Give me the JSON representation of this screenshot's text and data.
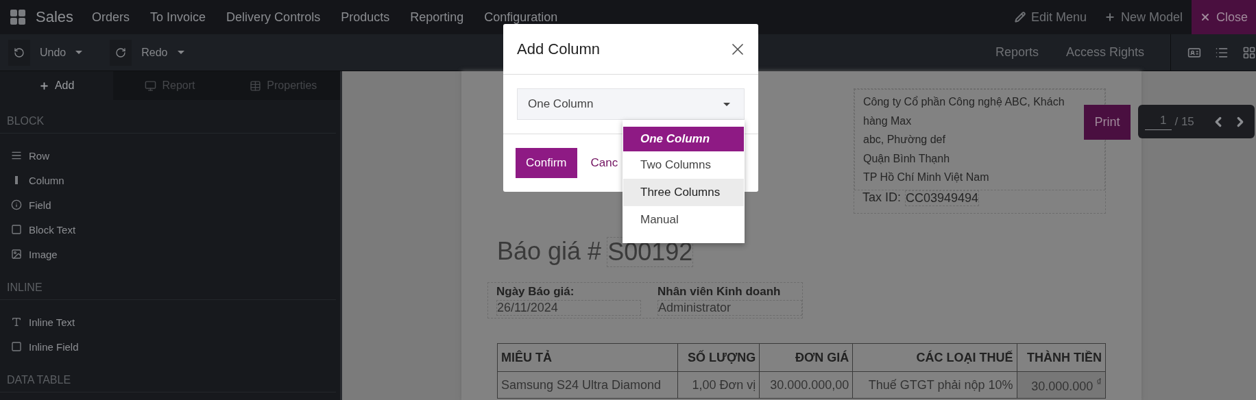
{
  "navbar": {
    "app": "Sales",
    "menu": [
      "Orders",
      "To Invoice",
      "Delivery Controls",
      "Products",
      "Reporting",
      "Configuration"
    ],
    "actions": [
      {
        "label": "Edit Menu",
        "kind": "edit"
      },
      {
        "label": "New Model",
        "kind": "new"
      },
      {
        "label": "Close",
        "kind": "close"
      }
    ]
  },
  "toolbar": {
    "history": [
      {
        "label": "Undo",
        "kind": "undo"
      },
      {
        "label": "Redo",
        "kind": "redo"
      }
    ],
    "links": [
      "Reports",
      "Access Rights"
    ]
  },
  "sidebar": {
    "tabs": [
      {
        "label": "Add",
        "kind": "add",
        "selected": true
      },
      {
        "label": "Report",
        "kind": "report",
        "selected": false
      },
      {
        "label": "Properties",
        "kind": "properties",
        "selected": false
      }
    ],
    "sections": [
      {
        "title": "BLOCK",
        "items": [
          {
            "label": "Row",
            "kind": "row"
          },
          {
            "label": "Column",
            "kind": "column"
          },
          {
            "label": "Field",
            "kind": "field"
          },
          {
            "label": "Block Text",
            "kind": "box"
          },
          {
            "label": "Image",
            "kind": "image"
          }
        ]
      },
      {
        "title": "INLINE",
        "items": [
          {
            "label": "Inline Text",
            "kind": "text"
          },
          {
            "label": "Inline Field",
            "kind": "box"
          }
        ]
      },
      {
        "title": "DATA TABLE"
      }
    ]
  },
  "report": {
    "address": [
      "Công ty Cổ phần Công nghệ ABC, Khách",
      "hàng Max",
      "abc, Phường def",
      "Quận Bình Thạnh",
      "TP Hồ Chí Minh Việt Nam"
    ],
    "tax_label": "Tax ID:",
    "tax_id": "CC03949494",
    "title": "Báo giá #",
    "number": "S00192",
    "info": [
      {
        "label": "Ngày Báo giá:",
        "value": "26/11/2024"
      },
      {
        "label": "Nhân viên Kinh doanh",
        "value": "Administrator"
      }
    ],
    "table": {
      "columns": [
        "MIÊU TẢ",
        "SỐ LƯỢNG",
        "ĐƠN GIÁ",
        "CÁC LOẠI THUẾ",
        "THÀNH TIỀN"
      ],
      "rows": [
        [
          "Samsung S24 Ultra Diamond",
          "1,00 Đơn vị",
          "30.000.000,00",
          "Thuế GTGT phải nộp 10%",
          "30.000.000 $^{₫}$"
        ]
      ]
    }
  },
  "print_button": "Print",
  "pager": {
    "current": "1",
    "total": "/ 15"
  },
  "dialog": {
    "title": "Add Column",
    "select": {
      "value": "One Column",
      "open": true,
      "options": [
        {
          "label": "One Column",
          "selected": true,
          "highlighted": false
        },
        {
          "label": "Two Columns",
          "selected": false,
          "highlighted": false
        },
        {
          "label": "Three Columns",
          "selected": false,
          "highlighted": true
        },
        {
          "label": "Manual",
          "selected": false,
          "highlighted": false
        }
      ]
    },
    "buttons": [
      {
        "label": "Confirm",
        "kind": "primary"
      },
      {
        "label": "Canc",
        "kind": "link"
      }
    ]
  }
}
